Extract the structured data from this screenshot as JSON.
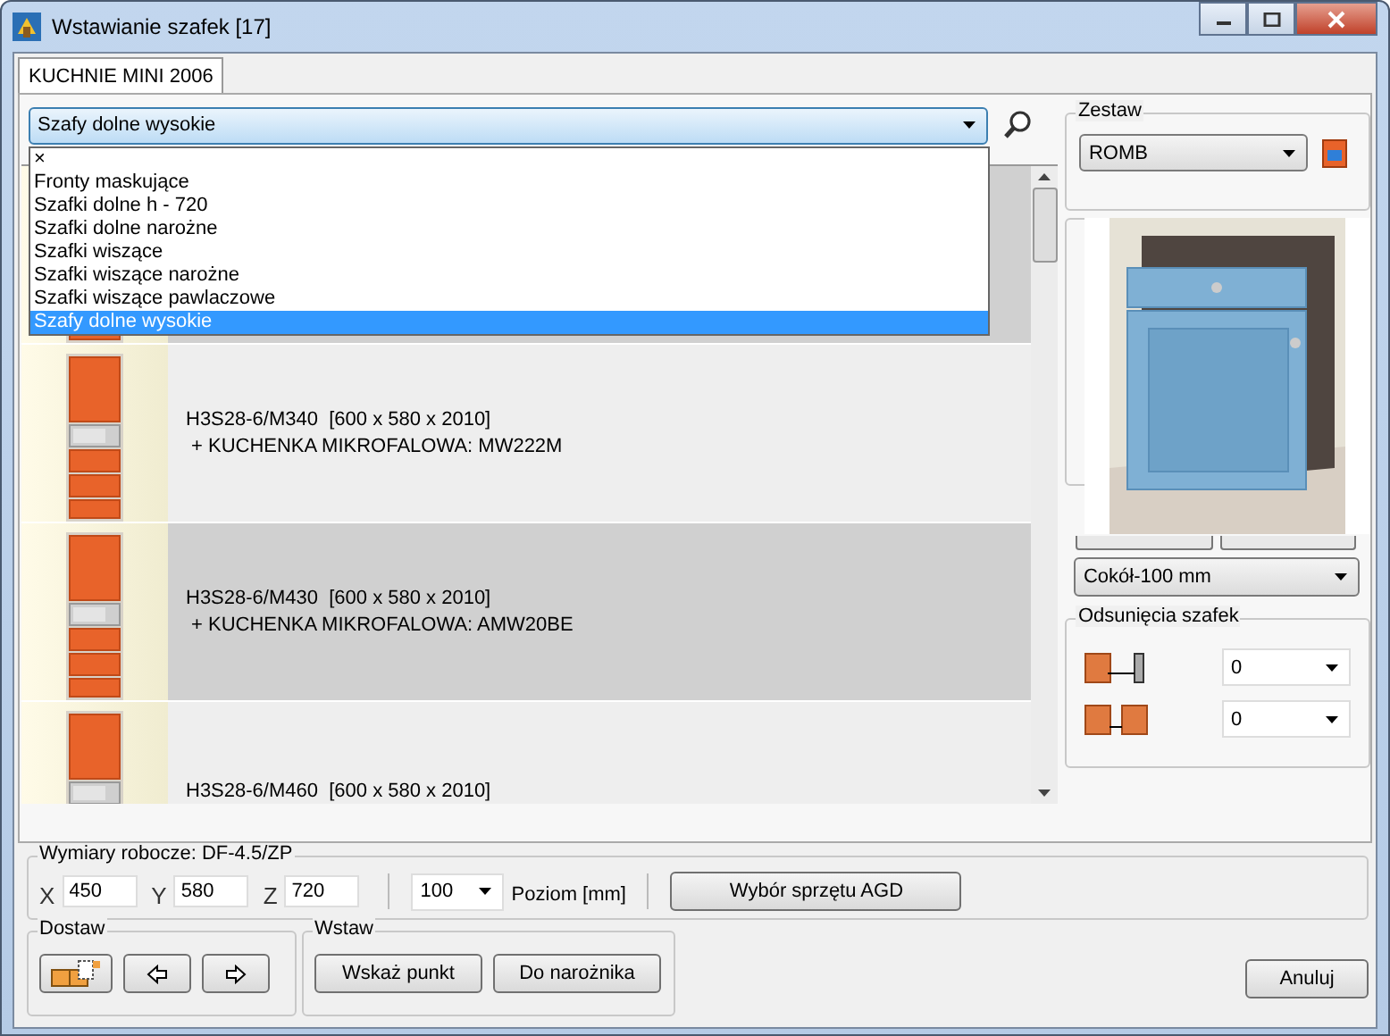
{
  "window": {
    "title": "Wstawianie szafek [17]"
  },
  "tabs": [
    {
      "label": "KUCHNIE MINI 2006",
      "selected": true
    }
  ],
  "category_select": {
    "value": "Szafy dolne wysokie",
    "expanded": true,
    "options": [
      {
        "label": "×",
        "selected": false
      },
      {
        "label": "Fronty maskujące",
        "selected": false
      },
      {
        "label": "Szafki dolne h - 720",
        "selected": false
      },
      {
        "label": "Szafki dolne narożne",
        "selected": false
      },
      {
        "label": "Szafki wiszące",
        "selected": false
      },
      {
        "label": "Szafki wiszące narożne",
        "selected": false
      },
      {
        "label": "Szafki wiszące pawlaczowe",
        "selected": false
      },
      {
        "label": "Szafy dolne wysokie",
        "selected": true
      }
    ]
  },
  "items": [
    {
      "kind": "tall-cabinet"
    },
    {
      "kind": "tall-cabinet-microwave",
      "lines": [
        "H3S28-6/M340  [600 x 580 x 2010]",
        "+ KUCHENKA MIKROFALOWA: MW222M"
      ]
    },
    {
      "kind": "tall-cabinet-microwave",
      "lines": [
        "H3S28-6/M430  [600 x 580 x 2010]",
        "+ KUCHENKA MIKROFALOWA: AMW20BE"
      ]
    },
    {
      "kind": "tall-cabinet-microwave",
      "lines": [
        "H3S28-6/M460  [600 x 580 x 2010]"
      ]
    }
  ],
  "zestaw": {
    "title": "Zestaw",
    "value": "ROMB"
  },
  "plinth_select": {
    "value": "Cokół-100 mm"
  },
  "offsets": {
    "title": "Odsunięcia szafek",
    "rows": [
      {
        "kind": "side",
        "value": "0"
      },
      {
        "kind": "between",
        "value": "0"
      }
    ]
  },
  "dimensions": {
    "title": "Wymiary robocze: DF-4.5/ZP",
    "fields": [
      {
        "label": "X",
        "value": "450"
      },
      {
        "label": "Y",
        "value": "580"
      },
      {
        "label": "Z",
        "value": "720"
      }
    ],
    "level_select": "100",
    "level_label": "Poziom [mm]",
    "agd_button": "Wybór sprzętu AGD"
  },
  "dostaw": {
    "title": "Dostaw"
  },
  "wstaw": {
    "title": "Wstaw",
    "buttons": [
      "Wskaż punkt",
      "Do narożnika"
    ]
  },
  "cancel_button": "Anuluj"
}
